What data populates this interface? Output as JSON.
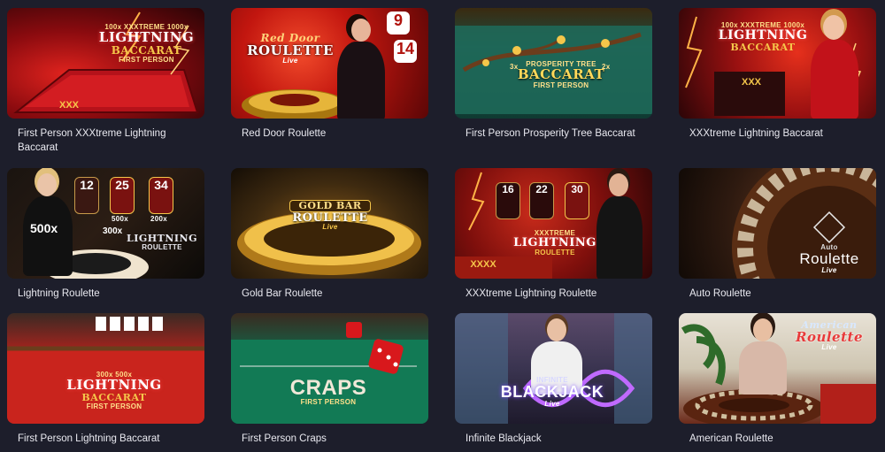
{
  "games": [
    {
      "title": "First Person XXXtreme Lightning Baccarat",
      "logo_top": "100x XXXTREME 1000x",
      "logo_main": "LIGHTNING",
      "logo_sub": "BACCARAT",
      "logo_tag": "FIRST PERSON",
      "badge": "XXX",
      "icon": "lightning-baccarat-thumbnail"
    },
    {
      "title": "Red Door Roulette",
      "logo_top": "Red Door",
      "logo_main": "ROULETTE",
      "logo_tag": "Live",
      "cards": [
        "9",
        "14"
      ],
      "icon": "red-door-roulette-thumbnail"
    },
    {
      "title": "First Person Prosperity Tree Baccarat",
      "logo_top": "PROSPERITY TREE",
      "logo_main": "BACCARAT",
      "logo_tag": "FIRST PERSON",
      "multipliers": [
        "3x",
        "2x"
      ],
      "icon": "prosperity-tree-thumbnail"
    },
    {
      "title": "XXXtreme Lightning Baccarat",
      "logo_top": "100x XXXTREME 1000x",
      "logo_main": "LIGHTNING",
      "logo_sub": "BACCARAT",
      "badge": "XXX",
      "icon": "xxxtreme-baccarat-thumbnail"
    },
    {
      "title": "Lightning Roulette",
      "logo_main": "LIGHTNING",
      "logo_sub": "ROULETTE",
      "numbers": [
        "12",
        "25",
        "34"
      ],
      "multipliers": [
        "500x",
        "200x",
        "500x",
        "300x"
      ],
      "icon": "lightning-roulette-thumbnail"
    },
    {
      "title": "Gold Bar Roulette",
      "logo_top": "GOLD BAR",
      "logo_main": "ROULETTE",
      "logo_tag": "Live",
      "icon": "gold-bar-roulette-thumbnail"
    },
    {
      "title": "XXXtreme Lightning Roulette",
      "logo_top": "XXXTREME",
      "logo_main": "LIGHTNING",
      "logo_sub": "ROULETTE",
      "numbers": [
        "16",
        "22",
        "30"
      ],
      "badge": "XXXX",
      "icon": "xxxtreme-roulette-thumbnail"
    },
    {
      "title": "Auto Roulette",
      "logo_top": "Auto",
      "logo_main": "Roulette",
      "logo_tag": "Live",
      "icon": "auto-roulette-thumbnail"
    },
    {
      "title": "First Person Lightning Baccarat",
      "logo_top": "300x 500x",
      "logo_main": "LIGHTNING",
      "logo_sub": "BACCARAT",
      "logo_tag": "FIRST PERSON",
      "icon": "first-person-lightning-baccarat-thumbnail"
    },
    {
      "title": "First Person Craps",
      "logo_main": "CRAPS",
      "logo_tag": "FIRST PERSON",
      "icon": "craps-thumbnail"
    },
    {
      "title": "Infinite Blackjack",
      "logo_top": "INFINITE",
      "logo_main": "BLACKJACK",
      "logo_tag": "Live",
      "icon": "infinite-blackjack-thumbnail"
    },
    {
      "title": "American Roulette",
      "logo_top": "American",
      "logo_main": "Roulette",
      "logo_tag": "Live",
      "icon": "american-roulette-thumbnail"
    }
  ],
  "colors": {
    "page_background": "#1d1e2b",
    "title_text": "#e9e9f0",
    "gold": "#f5c64a",
    "lightning_red": "#c0151b"
  }
}
